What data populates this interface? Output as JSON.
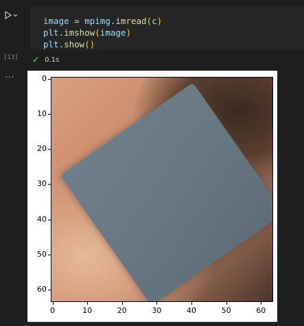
{
  "cell": {
    "code_lines": [
      [
        {
          "t": "image",
          "c": "tk-var"
        },
        {
          "t": " = ",
          "c": "tk-op"
        },
        {
          "t": "mpimg",
          "c": "tk-var"
        },
        {
          "t": ".",
          "c": "tk-op"
        },
        {
          "t": "imread",
          "c": "tk-fn"
        },
        {
          "t": "(",
          "c": "tk-par"
        },
        {
          "t": "c",
          "c": "tk-var"
        },
        {
          "t": ")",
          "c": "tk-par"
        }
      ],
      [
        {
          "t": "plt",
          "c": "tk-var"
        },
        {
          "t": ".",
          "c": "tk-op"
        },
        {
          "t": "imshow",
          "c": "tk-fn"
        },
        {
          "t": "(",
          "c": "tk-par"
        },
        {
          "t": "image",
          "c": "tk-var"
        },
        {
          "t": ")",
          "c": "tk-par"
        }
      ],
      [
        {
          "t": "plt",
          "c": "tk-var"
        },
        {
          "t": ".",
          "c": "tk-op"
        },
        {
          "t": "show",
          "c": "tk-fn"
        },
        {
          "t": "()",
          "c": "tk-par"
        }
      ]
    ],
    "execution_count": "[13]",
    "status_icon": "check-icon",
    "duration": "0.1s",
    "run_icon": "run-icon",
    "more_icon": "more-icon"
  },
  "output": {
    "y_ticks": [
      "0",
      "10",
      "20",
      "30",
      "40",
      "50",
      "60"
    ],
    "x_ticks": [
      "0",
      "10",
      "20",
      "30",
      "40",
      "50",
      "60"
    ]
  }
}
